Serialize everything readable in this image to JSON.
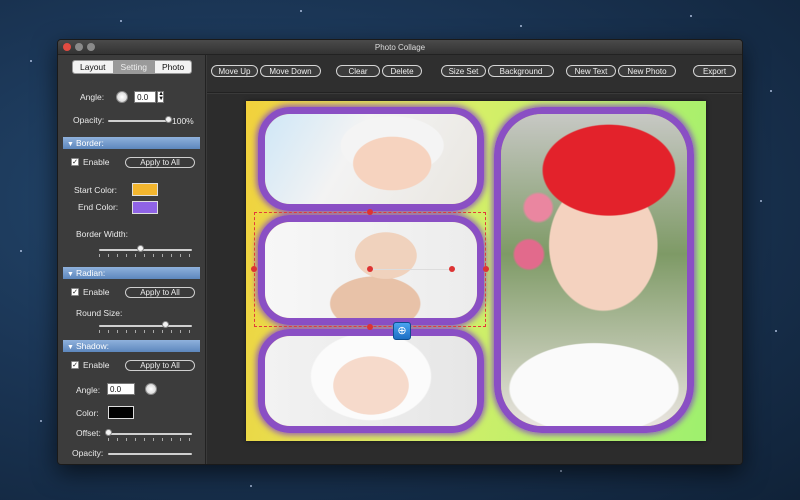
{
  "window": {
    "title": "Photo Collage"
  },
  "sidebar": {
    "tabs": [
      "Layout",
      "Setting",
      "Photo"
    ],
    "angle_label": "Angle:",
    "angle_value": "0.0",
    "opacity_label": "Opacity:",
    "opacity_value": "100%",
    "opacity_level": 1.0,
    "border": {
      "header": "Border:",
      "enable_label": "Enable",
      "apply_all": "Apply to All",
      "start_color_label": "Start Color:",
      "start_color": "#f2b52e",
      "end_color_label": "End Color:",
      "end_color": "#8f63e6",
      "width_label": "Border Width:",
      "width_level": 0.45
    },
    "radian": {
      "header": "Radian:",
      "enable_label": "Enable",
      "apply_all": "Apply to All",
      "round_label": "Round Size:",
      "round_level": 0.72
    },
    "shadow": {
      "header": "Shadow:",
      "enable_label": "Enable",
      "apply_all": "Apply to All",
      "angle_label": "Angle:",
      "angle_value": "0.0",
      "color_label": "Color:",
      "color": "#000000",
      "offset_label": "Offset:",
      "offset_level": 0.0,
      "opacity_label": "Opacity:"
    }
  },
  "toolbar": {
    "move_up": "Move Up",
    "move_down": "Move Down",
    "clear": "Clear",
    "delete": "Delete",
    "size_set": "Size Set",
    "background": "Background",
    "new_text": "New Text",
    "new_photo": "New Photo",
    "export": "Export"
  },
  "canvas": {
    "frame_border_color": "#8a4fc4",
    "frame_inner_color": "#e59a3a",
    "zoom_icon": "zoom-in-icon"
  }
}
